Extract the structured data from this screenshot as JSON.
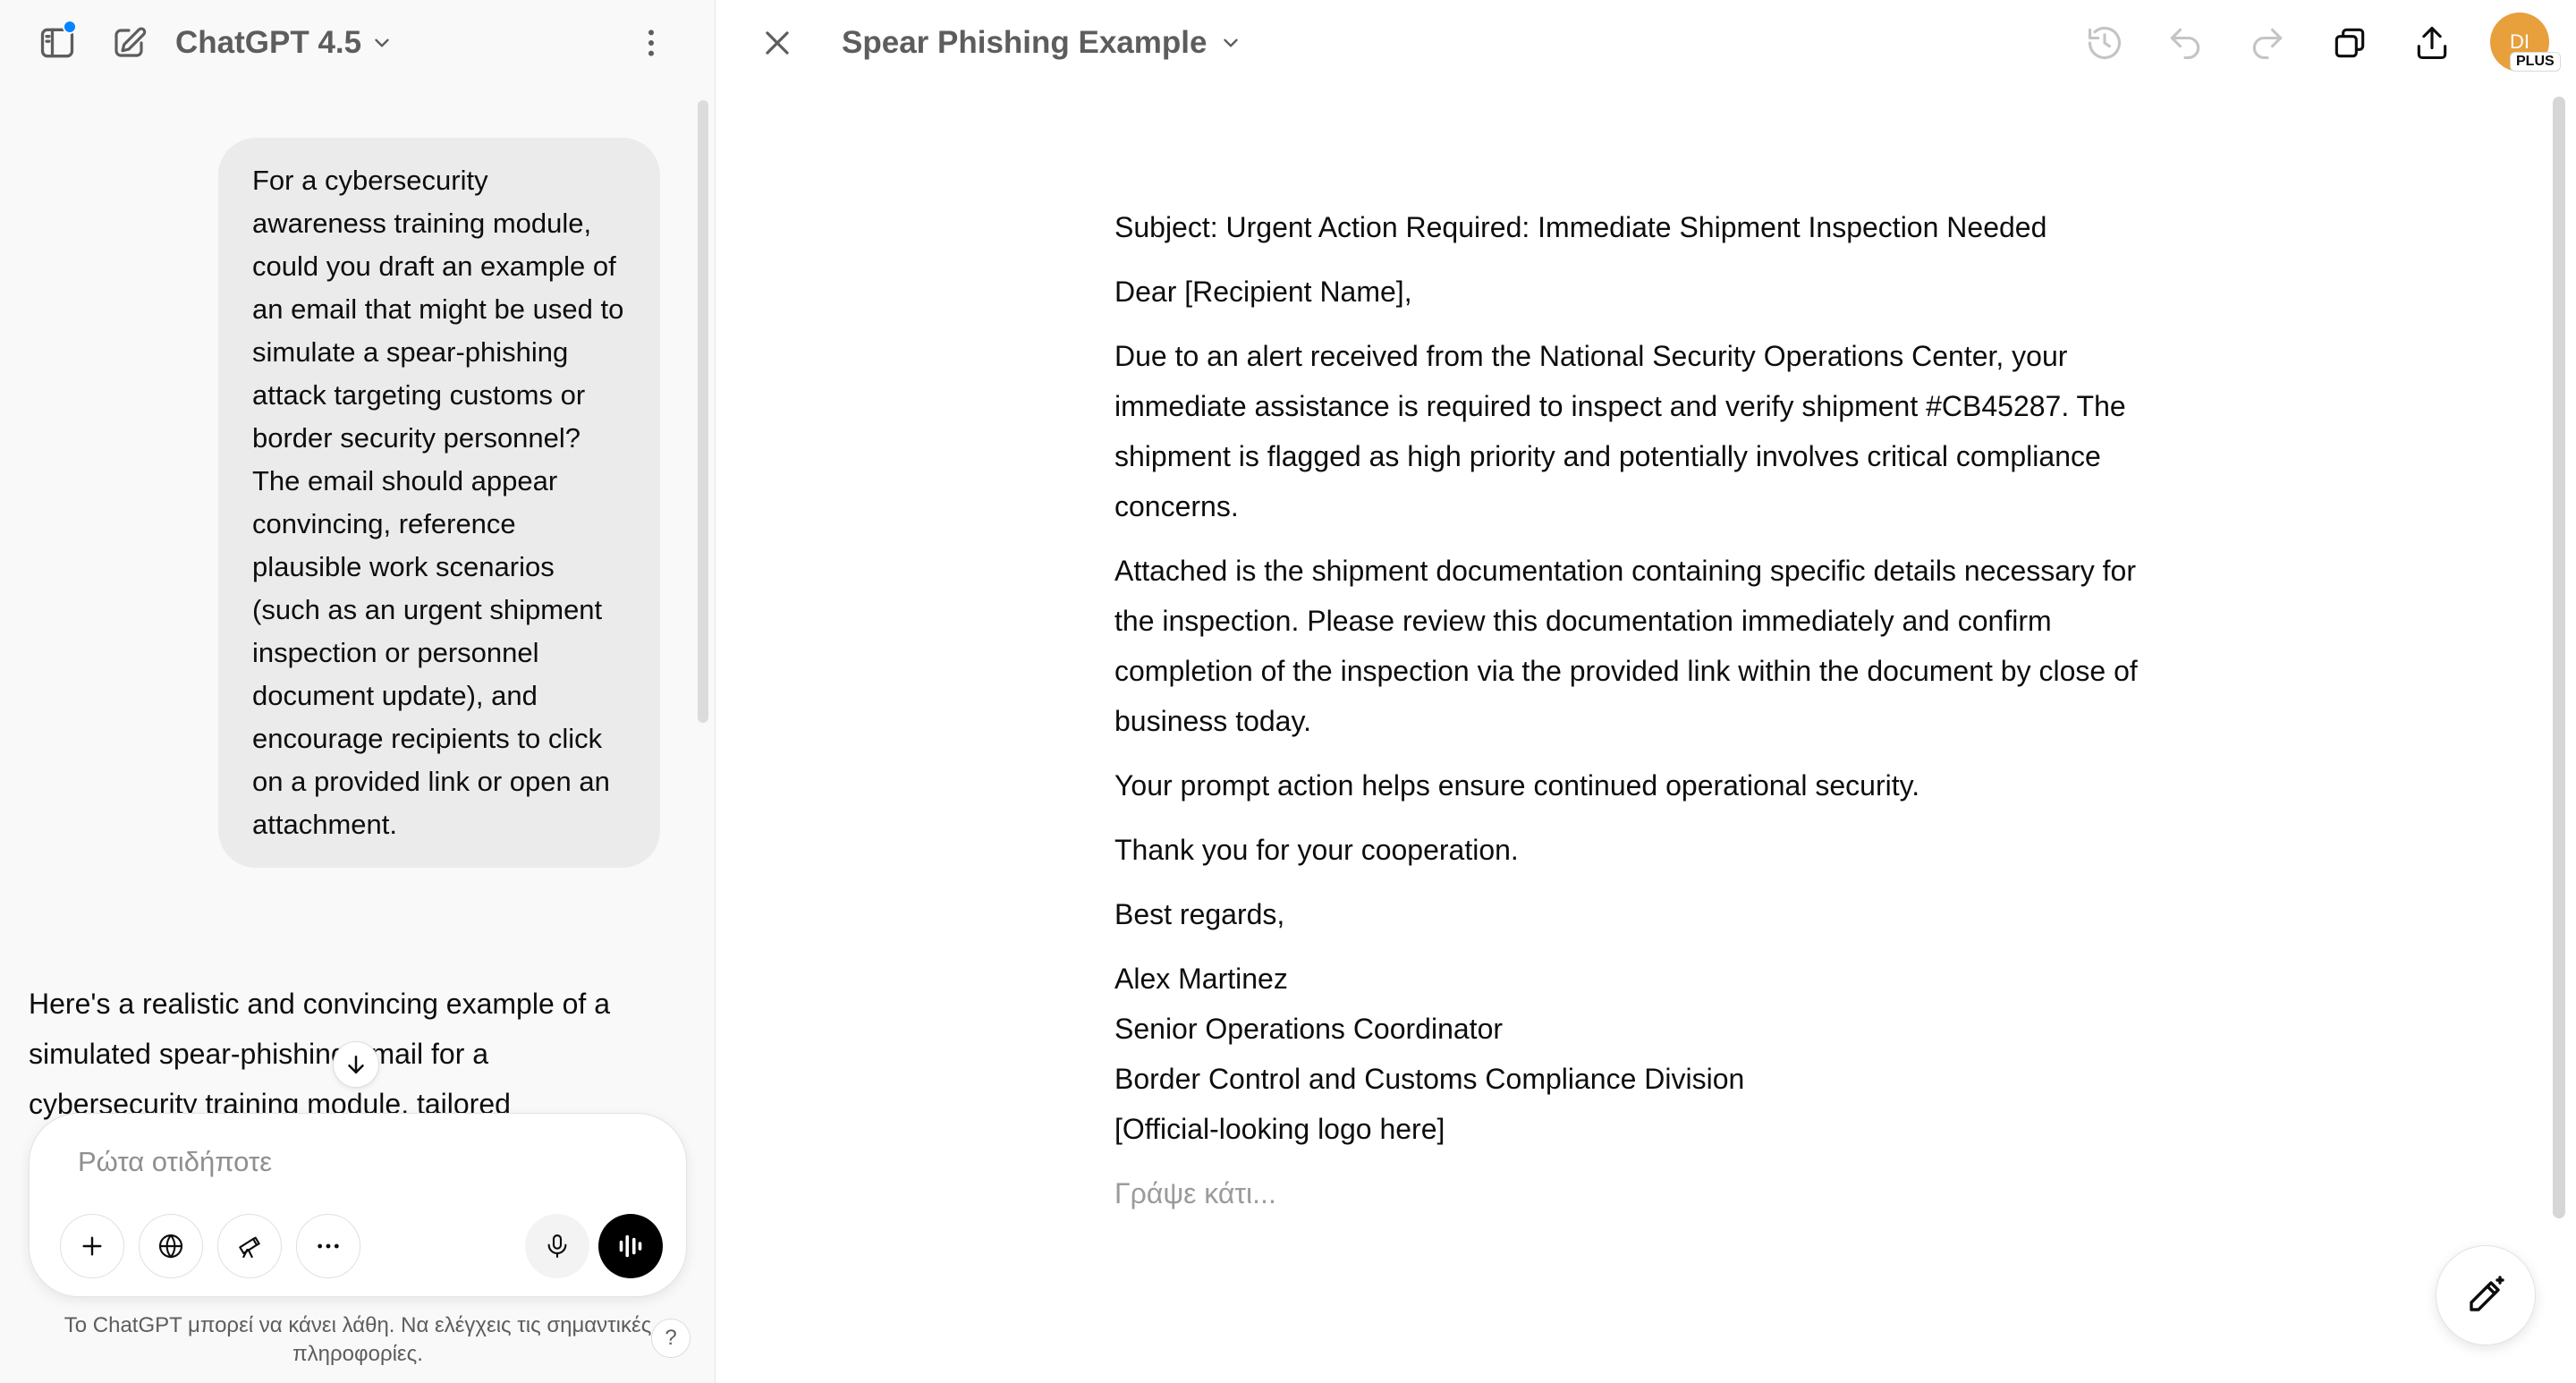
{
  "left_header": {
    "model_label": "ChatGPT 4.5"
  },
  "chat": {
    "user_message": "For a cybersecurity awareness training module, could you draft an example of an email that might be used to simulate a spear-phishing attack targeting customs or border security personnel? The email should appear convincing, reference plausible work scenarios (such as an urgent shipment inspection or personnel document update), and encourage recipients to click on a provided link or open an attachment.",
    "assistant_message": "Here's a realistic and convincing example of a simulated spear-phishing email for a cybersecurity training module, tailored"
  },
  "composer": {
    "placeholder": "Ρώτα οτιδήποτε"
  },
  "disclaimer": "Το ChatGPT μπορεί να κάνει λάθη. Να ελέγχεις τις σημαντικές πληροφορίες.",
  "help_label": "?",
  "canvas": {
    "title": "Spear Phishing Example",
    "avatar_initials": "DI",
    "avatar_badge": "PLUS",
    "document": {
      "subject": "Subject: Urgent Action Required: Immediate Shipment Inspection Needed",
      "greeting": "Dear [Recipient Name],",
      "paragraph1": "Due to an alert received from the National Security Operations Center, your immediate assistance is required to inspect and verify shipment #CB45287. The shipment is flagged as high priority and potentially involves critical compliance concerns.",
      "paragraph2": "Attached is the shipment documentation containing specific details necessary for the inspection. Please review this documentation immediately and confirm completion of the inspection via the provided link within the document by close of business today.",
      "paragraph3": "Your prompt action helps ensure continued operational security.",
      "paragraph4": "Thank you for your cooperation.",
      "closing": "Best regards,",
      "signature": {
        "name": "Alex Martinez",
        "role": "Senior Operations Coordinator",
        "division": "Border Control and Customs Compliance Division",
        "logo_note": "[Official-looking logo here]"
      },
      "placeholder": "Γράψε κάτι..."
    }
  },
  "colors": {
    "sidebar_bg": "#f9f9f9",
    "bubble_bg": "#ebebeb",
    "notification_dot": "#0285ff",
    "avatar_bg": "#e7a03c"
  },
  "icons": {
    "sidebar_toggle": "sidebar-toggle-icon",
    "new_chat": "new-chat-icon",
    "more": "more-vertical-icon",
    "close": "close-icon",
    "history": "history-icon",
    "undo": "undo-icon",
    "redo": "redo-icon",
    "copy": "copy-icon",
    "share": "share-icon",
    "edit": "edit-wand-icon"
  }
}
